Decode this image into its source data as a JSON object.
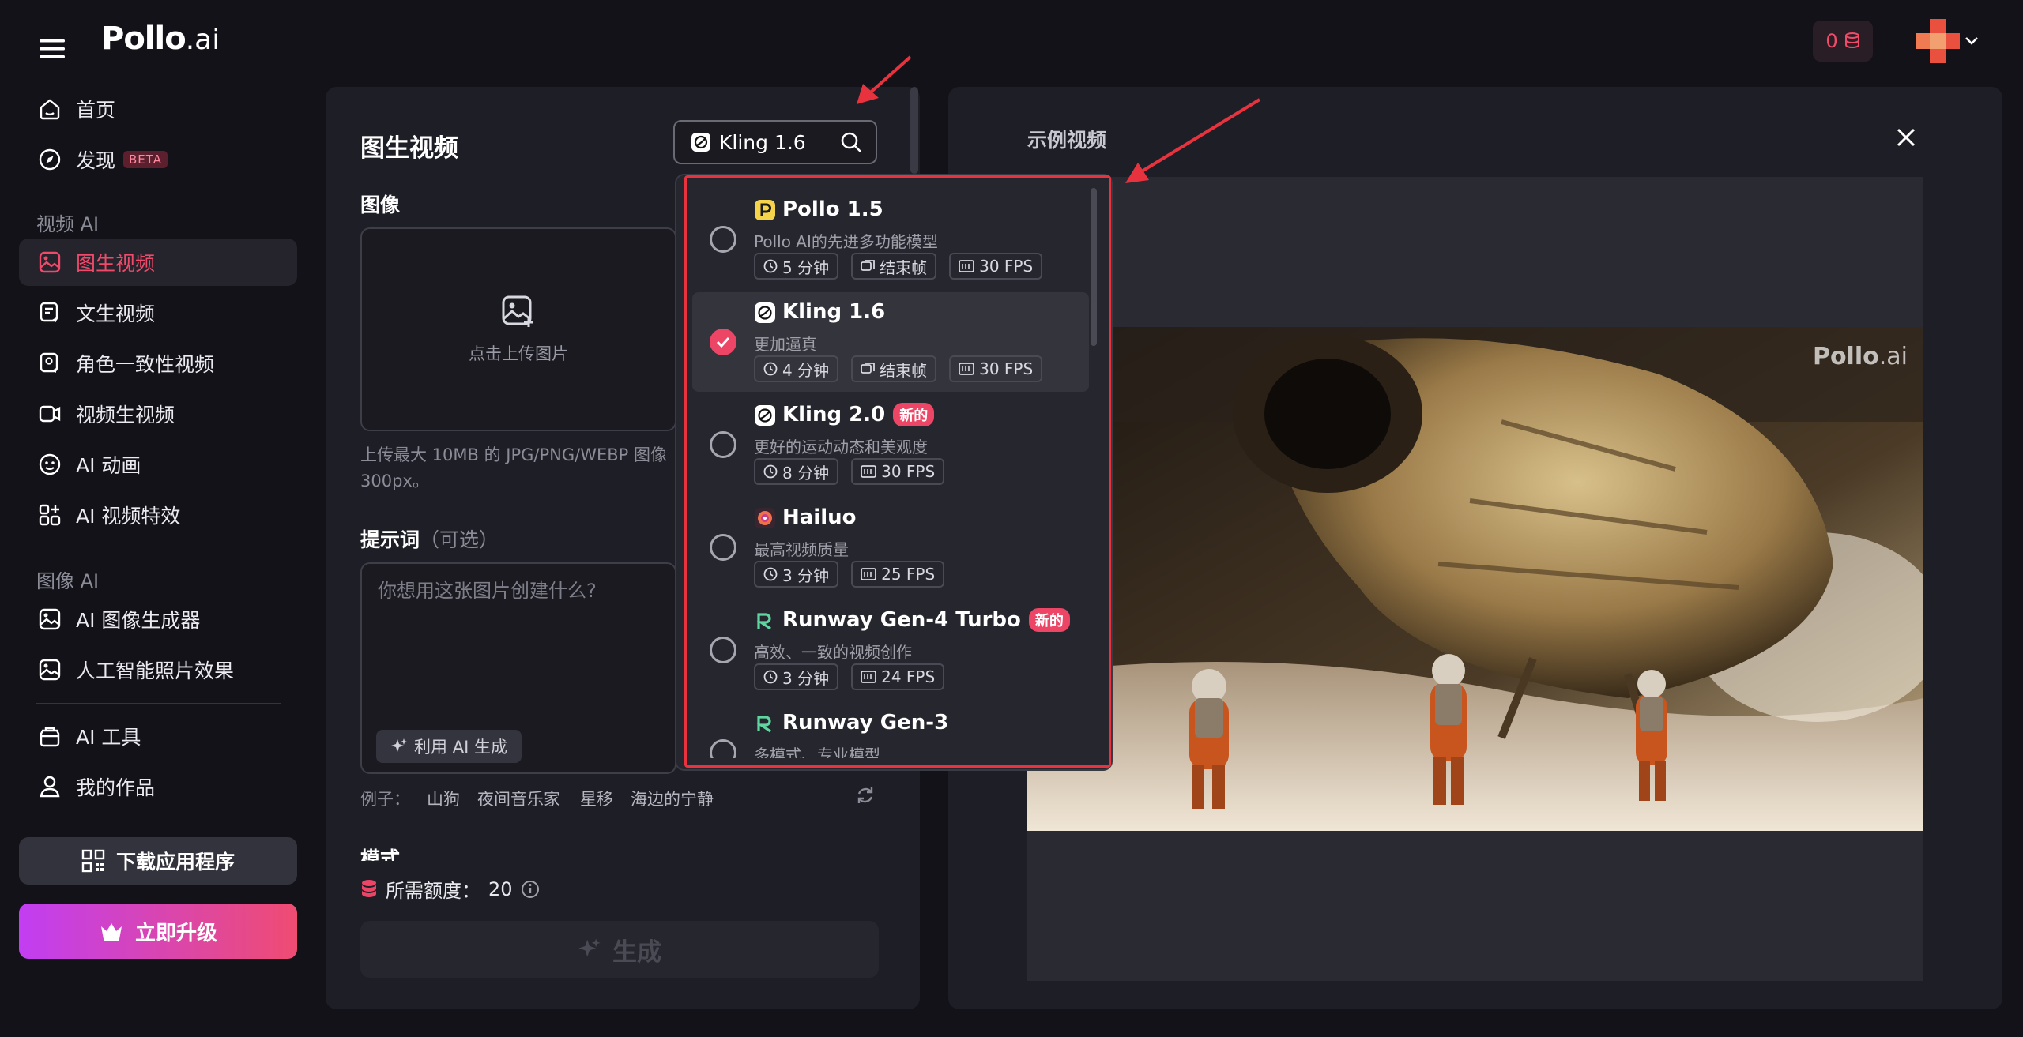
{
  "header": {
    "logo_main": "Pollo",
    "logo_suffix": ".ai",
    "credits": "0",
    "colors": {
      "accent": "#ef4a6a",
      "upgrade_from": "#c13ef2",
      "upgrade_to": "#ef4c72"
    }
  },
  "sidebar": {
    "home": "首页",
    "discover": "发现",
    "beta": "BETA",
    "section_video": "视频 AI",
    "img2video": "图生视频",
    "text2video": "文生视频",
    "consistent": "角色一致性视频",
    "video2video": "视频生视频",
    "animation": "AI 动画",
    "effects": "AI 视频特效",
    "section_image": "图像 AI",
    "imggen": "AI 图像生成器",
    "photofx": "人工智能照片效果",
    "tools": "AI 工具",
    "works": "我的作品",
    "download": "下载应用程序",
    "upgrade": "立即升级"
  },
  "left_panel": {
    "title": "图生视频",
    "model_selected": "Kling 1.6",
    "image_label": "图像",
    "upload_text": "点击上传图片",
    "upload_hint": "上传最大 10MB 的 JPG/PNG/WEBP 图像",
    "upload_hint2": "300px。",
    "prompt_label": "提示词",
    "prompt_optional": "（可选）",
    "prompt_placeholder": "你想用这张图片创建什么?",
    "ai_generate": "利用 AI 生成",
    "examples_label": "例子：",
    "examples": [
      "山狗",
      "夜间音乐家",
      "星移",
      "海边的宁静"
    ],
    "mode_label": "模式",
    "cost_label": "所需额度：",
    "cost_value": "20",
    "generate": "生成"
  },
  "right_panel": {
    "title": "示例视频",
    "watermark_main": "Pollo",
    "watermark_suffix": ".ai"
  },
  "model_dropdown": {
    "items": [
      {
        "name": "Pollo 1.5",
        "desc": "Pollo AI的先进多功能模型",
        "time": "5 分钟",
        "end": "结束帧",
        "fps": "30 FPS",
        "selected": false
      },
      {
        "name": "Kling 1.6",
        "desc": "更加逼真",
        "time": "4 分钟",
        "end": "结束帧",
        "fps": "30 FPS",
        "selected": true
      },
      {
        "name": "Kling 2.0",
        "badge": "新的",
        "desc": "更好的运动动态和美观度",
        "time": "8 分钟",
        "fps": "30 FPS",
        "selected": false
      },
      {
        "name": "Hailuo",
        "desc": "最高视频质量",
        "time": "3 分钟",
        "fps": "25 FPS",
        "selected": false
      },
      {
        "name": "Runway Gen-4 Turbo",
        "badge": "新的",
        "desc": "高效、一致的视频创作",
        "time": "3 分钟",
        "fps": "24 FPS",
        "selected": false
      },
      {
        "name": "Runway Gen-3",
        "desc": "多模式、专业模型",
        "selected": false
      }
    ]
  }
}
